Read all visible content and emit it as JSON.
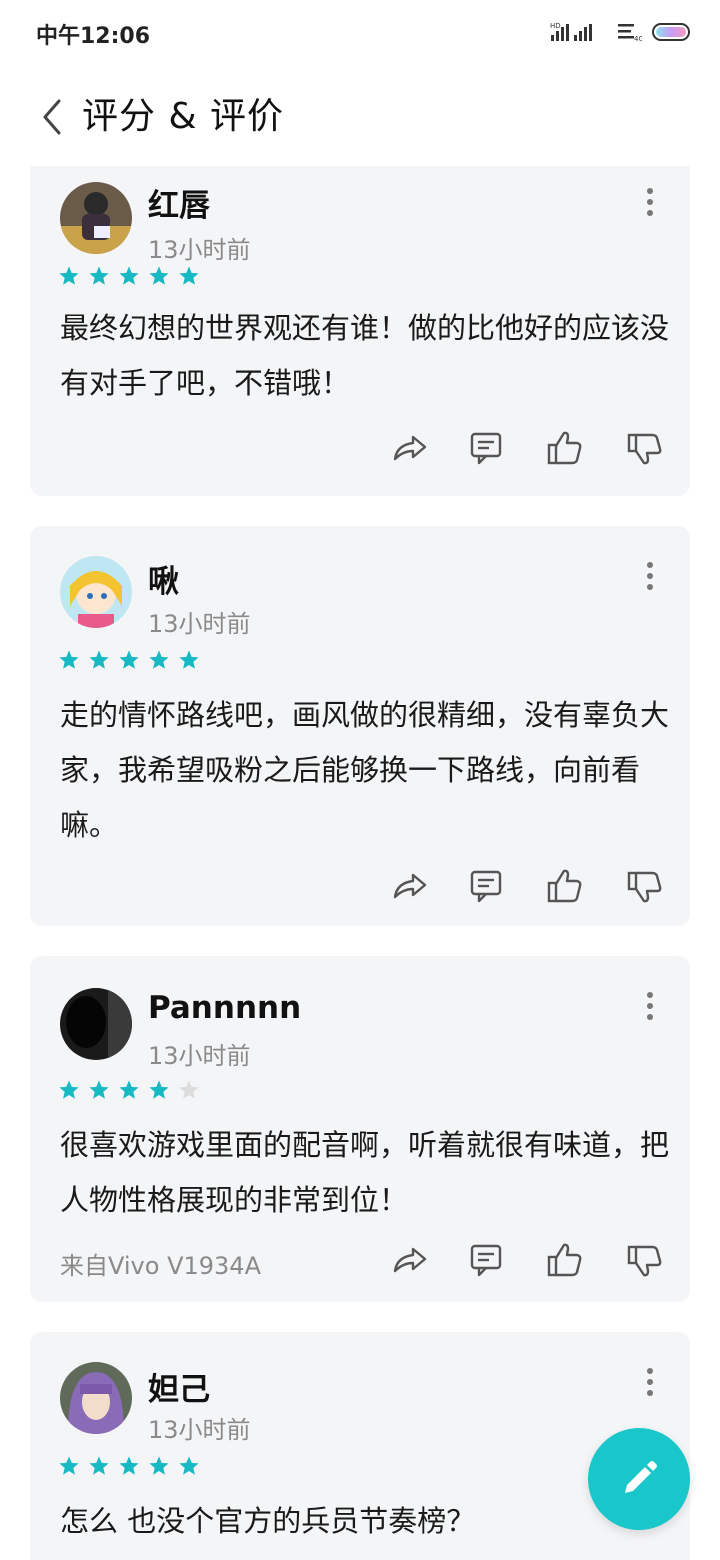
{
  "status_bar": {
    "time": "中午12:06"
  },
  "header": {
    "title": "评分 & 评价"
  },
  "colors": {
    "accent": "#19c6c9",
    "star_filled": "#19b9c4",
    "star_empty": "#dcdcdc",
    "card_bg": "#f4f5f7"
  },
  "reviews": [
    {
      "username": "红唇",
      "time": "13小时前",
      "rating": 5,
      "text": "最终幻想的世界观还有谁！做的比他好的应该没有对手了吧，不错哦！"
    },
    {
      "username": "啾",
      "time": "13小时前",
      "rating": 5,
      "text": "走的情怀路线吧，画风做的很精细，没有辜负大家，我希望吸粉之后能够换一下路线，向前看嘛。"
    },
    {
      "username": "Pannnnn",
      "time": "13小时前",
      "rating": 4,
      "text": "很喜欢游戏里面的配音啊，听着就很有味道，把人物性格展现的非常到位！",
      "device": "来自Vivo V1934A"
    },
    {
      "username": "妲己",
      "time": "13小时前",
      "rating": 5,
      "text": "怎么 也没个官方的兵员节奏榜？"
    }
  ],
  "icons": {
    "back": "chevron-left-icon",
    "share": "share-icon",
    "comment": "comment-icon",
    "like": "thumbs-up-icon",
    "dislike": "thumbs-down-icon",
    "more": "more-vertical-icon",
    "fab": "pencil-icon"
  }
}
